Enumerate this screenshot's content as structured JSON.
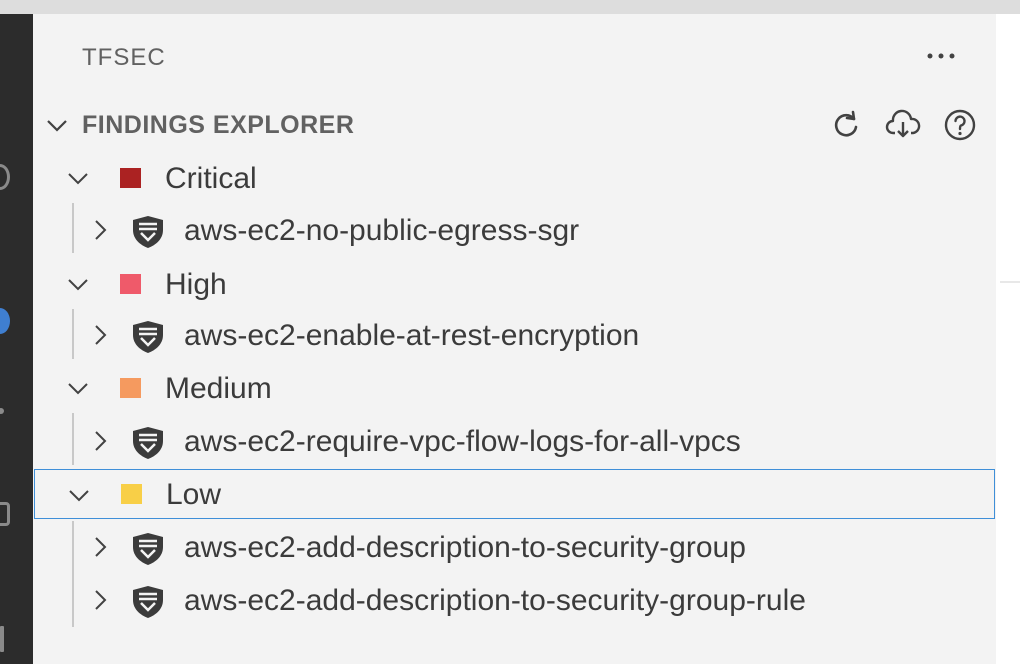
{
  "panel": {
    "title": "TFSEC",
    "more_label": "···"
  },
  "section": {
    "title": "FINDINGS EXPLORER",
    "actions": [
      {
        "icon": "refresh-icon"
      },
      {
        "icon": "cloud-download-icon"
      },
      {
        "icon": "help-icon"
      }
    ]
  },
  "colors": {
    "critical": "#ab2222",
    "high": "#ef5a6a",
    "medium": "#f59a5f",
    "low": "#f8cf47",
    "focus": "#3f8fd8"
  },
  "tree": {
    "critical": {
      "label": "Critical",
      "checks": [
        "aws-ec2-no-public-egress-sgr"
      ]
    },
    "high": {
      "label": "High",
      "checks": [
        "aws-ec2-enable-at-rest-encryption"
      ]
    },
    "medium": {
      "label": "Medium",
      "checks": [
        "aws-ec2-require-vpc-flow-logs-for-all-vpcs"
      ]
    },
    "low": {
      "label": "Low",
      "checks": [
        "aws-ec2-add-description-to-security-group",
        "aws-ec2-add-description-to-security-group-rule"
      ]
    }
  }
}
